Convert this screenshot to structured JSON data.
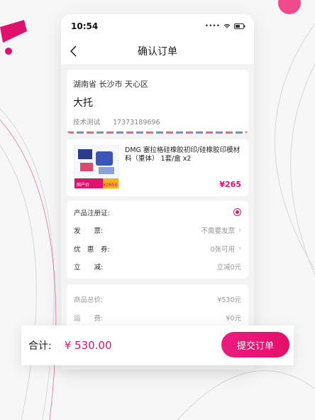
{
  "colors": {
    "accent": "#e0126f",
    "background": "#f7f7f8"
  },
  "status_bar": {
    "time": "10:54",
    "icons": [
      "location-icon",
      "signal-icon",
      "wifi-icon",
      "battery-icon"
    ]
  },
  "nav": {
    "title": "确认订单",
    "back_icon": "chevron-left-icon"
  },
  "address": {
    "region": "湖南省 长沙市 天心区",
    "name": "大托",
    "contact": "技术测试",
    "phone": "17373189696"
  },
  "product": {
    "name": "DMG 塞拉格硅橡胶初印/硅橡胶印模材料（重体） 1套/盒 x2",
    "price": "¥265",
    "thumb_tag": "国产价",
    "thumb_price": "¥2650"
  },
  "options": [
    {
      "label": "产品注册证:",
      "value": "",
      "control": "radio-selected"
    },
    {
      "label": "发　　票:",
      "value": "不需要发票",
      "control": "chevron"
    },
    {
      "label": "优　惠　券:",
      "value": "0张可用",
      "control": "chevron"
    },
    {
      "label": "立　　减:",
      "value": "立减0元",
      "control": "none"
    }
  ],
  "totals": [
    {
      "label": "商品总价:",
      "value": "¥530元"
    },
    {
      "label": "运　　费:",
      "value": "¥0元"
    }
  ],
  "footer": {
    "label": "合计:",
    "amount": "¥ 530.00",
    "submit": "提交订单"
  }
}
